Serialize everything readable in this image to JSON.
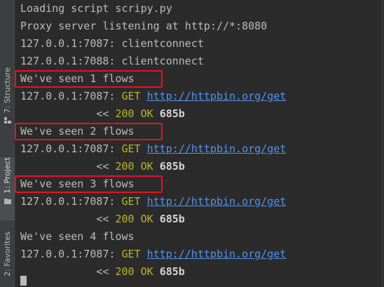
{
  "sidebar": {
    "tabs": [
      {
        "label": "7: Structure",
        "icon": "structure-icon",
        "active": false
      },
      {
        "label": "1: Project",
        "icon": "folder-icon",
        "active": true
      },
      {
        "label": "2: Favorites",
        "icon": "star-icon",
        "active": false
      }
    ]
  },
  "console": {
    "lines": [
      {
        "kind": "text",
        "text": "Loading script scripy.py"
      },
      {
        "kind": "text",
        "text": "Proxy server listening at http://*:8080"
      },
      {
        "kind": "text",
        "text": "127.0.0.1:7087: clientconnect"
      },
      {
        "kind": "text",
        "text": "127.0.0.1:7088: clientconnect"
      },
      {
        "kind": "text",
        "text": "We've seen 1 flows",
        "highlighted": true
      },
      {
        "kind": "request",
        "prefix": "127.0.0.1:7087: ",
        "method": "GET",
        "url": "http://httpbin.org/get"
      },
      {
        "kind": "response",
        "arrow": "            << ",
        "status": "200",
        "reason": "OK",
        "size": "685b"
      },
      {
        "kind": "text",
        "text": "We've seen 2 flows",
        "highlighted": true
      },
      {
        "kind": "request",
        "prefix": "127.0.0.1:7087: ",
        "method": "GET",
        "url": "http://httpbin.org/get"
      },
      {
        "kind": "response",
        "arrow": "            << ",
        "status": "200",
        "reason": "OK",
        "size": "685b"
      },
      {
        "kind": "text",
        "text": "We've seen 3 flows",
        "highlighted": true
      },
      {
        "kind": "request",
        "prefix": "127.0.0.1:7087: ",
        "method": "GET",
        "url": "http://httpbin.org/get"
      },
      {
        "kind": "response",
        "arrow": "            << ",
        "status": "200",
        "reason": "OK",
        "size": "685b"
      },
      {
        "kind": "text",
        "text": "We've seen 4 flows"
      },
      {
        "kind": "request",
        "prefix": "127.0.0.1:7087: ",
        "method": "GET",
        "url": "http://httpbin.org/get"
      },
      {
        "kind": "response",
        "arrow": "            << ",
        "status": "200",
        "reason": "OK",
        "size": "685b"
      }
    ]
  },
  "colors": {
    "background": "#2b2b2b",
    "text": "#bbbbbb",
    "method": "#bbb529",
    "link": "#5394ec",
    "highlight_border": "#e81123"
  }
}
